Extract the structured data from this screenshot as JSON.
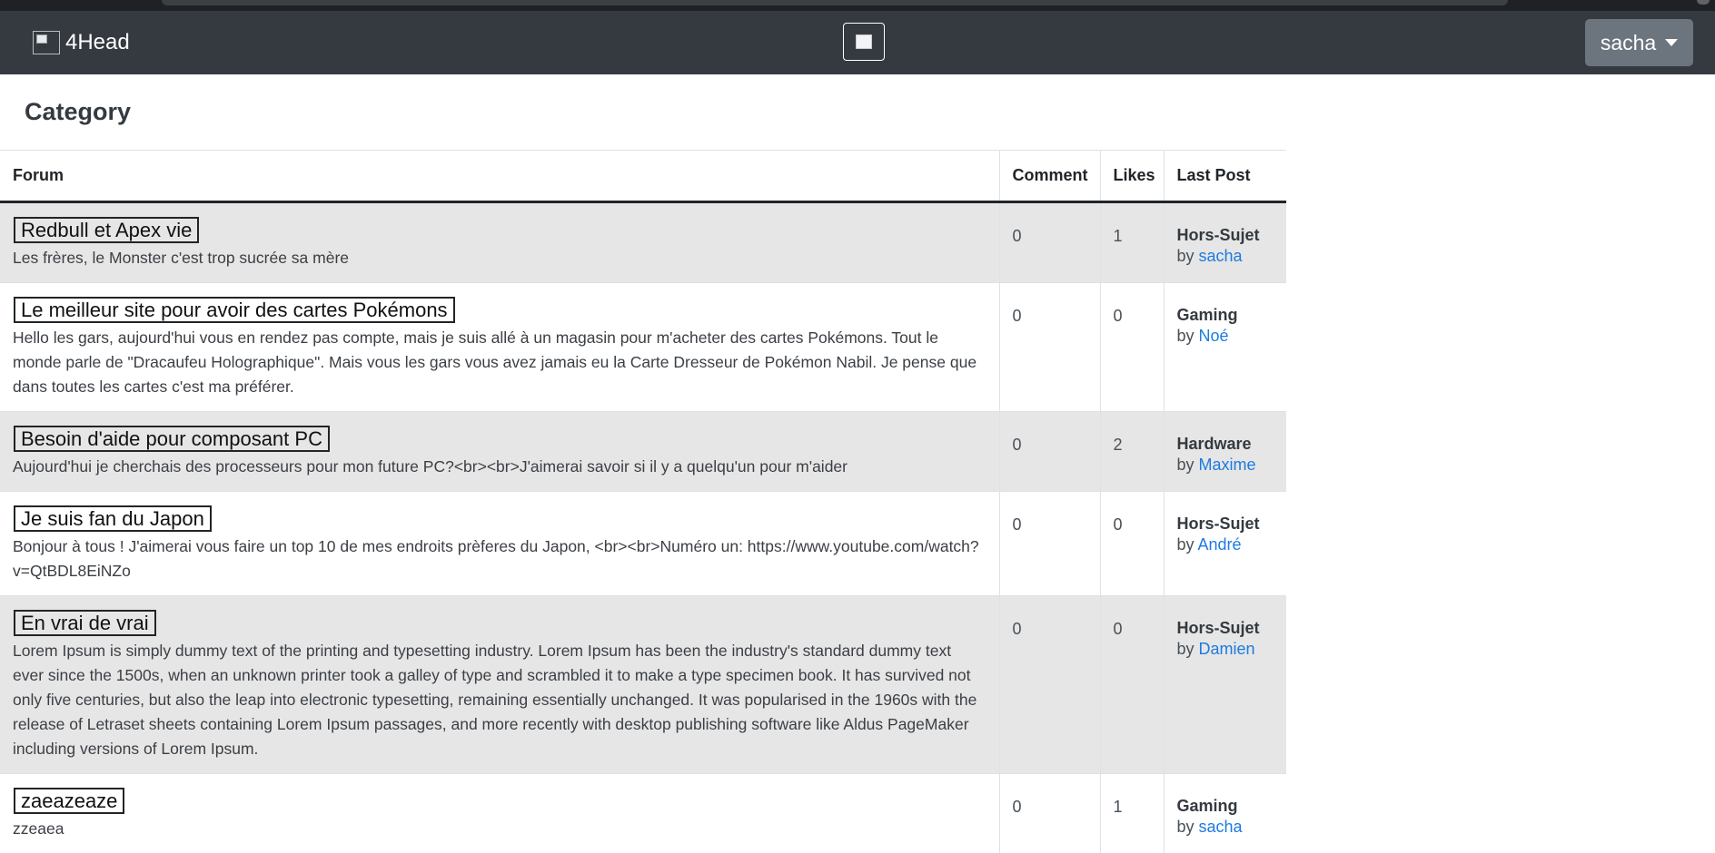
{
  "navbar": {
    "brand": "4Head",
    "user_label": "sacha"
  },
  "page_title": "Category",
  "table": {
    "headers": [
      "Forum",
      "Comment",
      "Likes",
      "Last Post"
    ],
    "by_prefix": "by",
    "rows": [
      {
        "title": "Redbull et Apex vie",
        "description": "Les frères, le Monster c'est trop sucrée sa mère",
        "comments": "0",
        "likes": "1",
        "category": "Hors-Sujet",
        "author": "sacha"
      },
      {
        "title": "Le meilleur site pour avoir des cartes Pokémons",
        "description": "Hello les gars, aujourd'hui vous en rendez pas compte, mais je suis allé à un magasin pour m'acheter des cartes Pokémons. Tout le monde parle de \"Dracaufeu Holographique\". Mais vous les gars vous avez jamais eu la Carte Dresseur de Pokémon Nabil. Je pense que dans toutes les cartes c'est ma préférer.",
        "comments": "0",
        "likes": "0",
        "category": "Gaming",
        "author": "Noé"
      },
      {
        "title": "Besoin d'aide pour composant PC",
        "description": "Aujourd'hui je cherchais des processeurs pour mon future PC?<br><br>J'aimerai savoir si il y a quelqu'un pour m'aider",
        "comments": "0",
        "likes": "2",
        "category": "Hardware",
        "author": "Maxime"
      },
      {
        "title": "Je suis fan du Japon",
        "description": "Bonjour à tous ! J'aimerai vous faire un top 10 de mes endroits prèferes du Japon, <br><br>Numéro un: https://www.youtube.com/watch?v=QtBDL8EiNZo",
        "comments": "0",
        "likes": "0",
        "category": "Hors-Sujet",
        "author": "André"
      },
      {
        "title": "En vrai de vrai",
        "description": "Lorem Ipsum is simply dummy text of the printing and typesetting industry. Lorem Ipsum has been the industry's standard dummy text ever since the 1500s, when an unknown printer took a galley of type and scrambled it to make a type specimen book. It has survived not only five centuries, but also the leap into electronic typesetting, remaining essentially unchanged. It was popularised in the 1960s with the release of Letraset sheets containing Lorem Ipsum passages, and more recently with desktop publishing software like Aldus PageMaker including versions of Lorem Ipsum.",
        "comments": "0",
        "likes": "0",
        "category": "Hors-Sujet",
        "author": "Damien"
      },
      {
        "title": "zaeazeaze",
        "description": "zzeaea",
        "comments": "0",
        "likes": "1",
        "category": "Gaming",
        "author": "sacha"
      }
    ]
  }
}
